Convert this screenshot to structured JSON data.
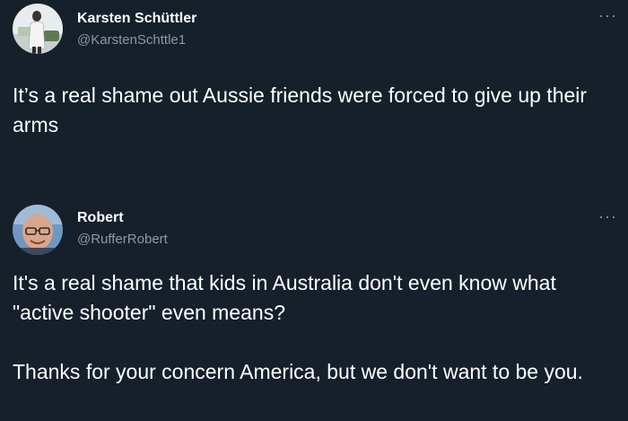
{
  "tweets": [
    {
      "name": "Karsten Schüttler",
      "handle": "@KarstenSchttle1",
      "more_label": "···",
      "paragraphs": [
        "It’s a real shame out Aussie friends were forced to give up their arms"
      ]
    },
    {
      "name": "Robert",
      "handle": "@RufferRobert",
      "more_label": "···",
      "paragraphs": [
        "It's a real shame that kids in Australia don't even know what \"active shooter\" even means?",
        "Thanks for your concern America, but we don't want to be you."
      ]
    }
  ],
  "colors": {
    "background": "#15202b",
    "handle": "#8b98a5",
    "text": "#ffffff"
  }
}
